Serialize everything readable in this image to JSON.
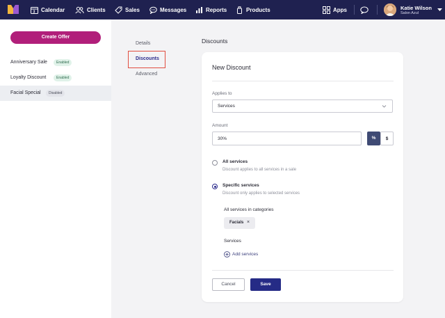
{
  "nav": {
    "items": [
      {
        "label": "Calendar",
        "icon": "calendar-icon"
      },
      {
        "label": "Clients",
        "icon": "clients-icon"
      },
      {
        "label": "Sales",
        "icon": "sales-tag-icon"
      },
      {
        "label": "Messages",
        "icon": "messages-icon"
      },
      {
        "label": "Reports",
        "icon": "reports-icon"
      },
      {
        "label": "Products",
        "icon": "products-icon"
      }
    ],
    "apps_label": "Apps",
    "user_name": "Katie Wilson",
    "user_location": "Salon Azul"
  },
  "sidebar": {
    "create_label": "Create Offer",
    "offers": [
      {
        "name": "Anniversary Sale",
        "status": "Enabled"
      },
      {
        "name": "Loyalty Discount",
        "status": "Enabled"
      },
      {
        "name": "Facial Special",
        "status": "Disabled"
      }
    ]
  },
  "tabs": {
    "details": "Details",
    "discounts": "Discounts",
    "advanced": "Advanced"
  },
  "page_title": "Discounts",
  "form": {
    "title": "New Discount",
    "applies_to_label": "Applies to",
    "applies_to_value": "Services",
    "amount_label": "Amount",
    "amount_value": "30%",
    "percent_label": "%",
    "dollar_label": "$",
    "options": [
      {
        "title": "All services",
        "description": "Discount applies to all services in a sale",
        "checked": false
      },
      {
        "title": "Specific services",
        "description": "Discount only applies to selected services",
        "checked": true
      }
    ],
    "categories_label": "All services in categories",
    "chip_label": "Facials",
    "services_label": "Services",
    "add_services_label": "Add services",
    "cancel_label": "Cancel",
    "save_label": "Save"
  },
  "colors": {
    "topbar": "#1f2150",
    "accent": "#b11f7a",
    "primary": "#252b86",
    "highlight_border": "#e14d3f"
  }
}
